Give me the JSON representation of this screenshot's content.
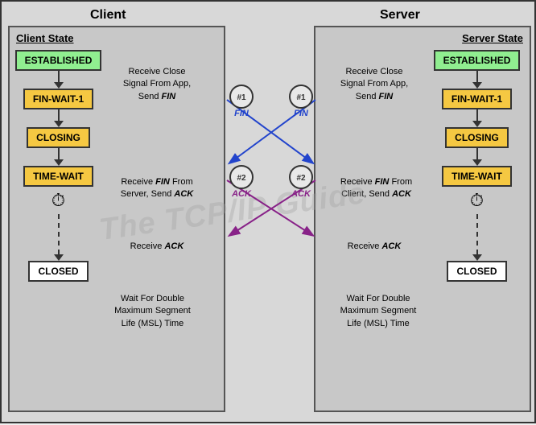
{
  "title": {
    "client": "Client",
    "server": "Server"
  },
  "client": {
    "state_label": "Client State",
    "states": [
      {
        "label": "ESTABLISHED",
        "type": "green"
      },
      {
        "label": "FIN-WAIT-1",
        "type": "yellow"
      },
      {
        "label": "CLOSING",
        "type": "yellow"
      },
      {
        "label": "TIME-WAIT",
        "type": "yellow"
      },
      {
        "label": "CLOSED",
        "type": "white"
      }
    ],
    "descriptions": [
      {
        "text": "Receive Close\nSignal From App,\nSend FIN"
      },
      {
        "text": "Receive FIN From\nServer, Send ACK"
      },
      {
        "text": "Receive ACK"
      },
      {
        "text": "Wait For Double\nMaximum Segment\nLife (MSL) Time"
      }
    ]
  },
  "server": {
    "state_label": "Server State",
    "states": [
      {
        "label": "ESTABLISHED",
        "type": "green"
      },
      {
        "label": "FIN-WAIT-1",
        "type": "yellow"
      },
      {
        "label": "CLOSING",
        "type": "yellow"
      },
      {
        "label": "TIME-WAIT",
        "type": "yellow"
      },
      {
        "label": "CLOSED",
        "type": "white"
      }
    ],
    "descriptions": [
      {
        "text": "Receive Close\nSignal From App,\nSend FIN"
      },
      {
        "text": "Receive FIN From\nClient, Send ACK"
      },
      {
        "text": "Receive ACK"
      },
      {
        "text": "Wait For Double\nMaximum Segment\nLife (MSL) Time"
      }
    ]
  },
  "packets": [
    {
      "id": "#1",
      "label": "FIN"
    },
    {
      "id": "#2",
      "label": "ACK"
    }
  ],
  "watermark": "The TCP/IP Guide"
}
